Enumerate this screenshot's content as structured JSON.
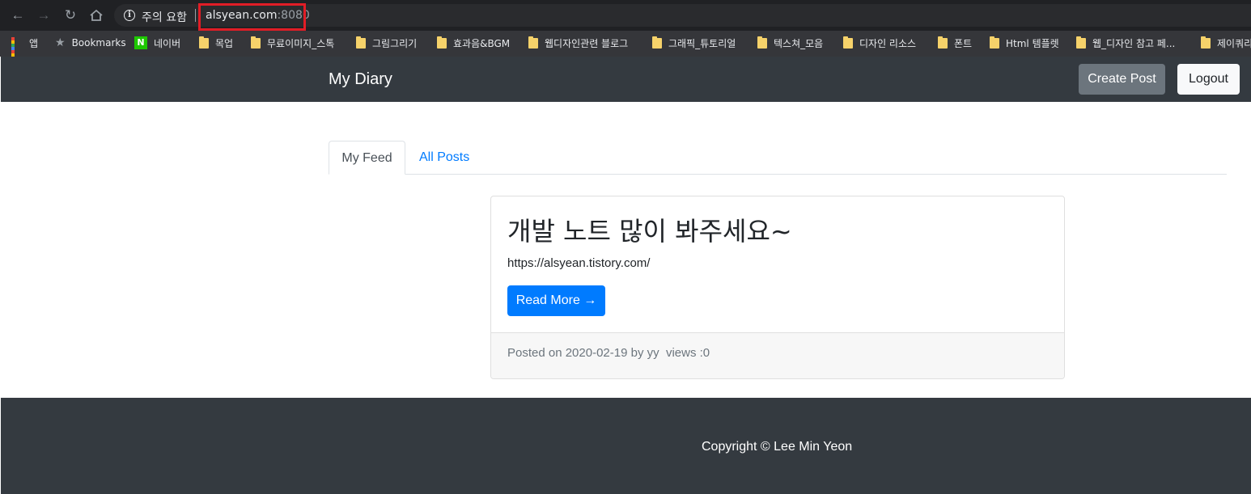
{
  "browser": {
    "security_label": "주의 요함",
    "url_host": "alsyean.com",
    "url_port": ":8080"
  },
  "bookmarks": [
    {
      "label": "앱",
      "icon": "apps-grid-icon"
    },
    {
      "label": "Bookmarks",
      "icon": "star-icon"
    },
    {
      "label": "네이버",
      "icon": "naver-icon"
    },
    {
      "label": "목업",
      "icon": "folder-icon"
    },
    {
      "label": "무료이미지_스톡",
      "icon": "folder-icon"
    },
    {
      "label": "그림그리기",
      "icon": "folder-icon"
    },
    {
      "label": "효과음&BGM",
      "icon": "folder-icon"
    },
    {
      "label": "웹디자인관련 블로그",
      "icon": "folder-icon"
    },
    {
      "label": "그래픽_튜토리얼",
      "icon": "folder-icon"
    },
    {
      "label": "텍스쳐_모음",
      "icon": "folder-icon"
    },
    {
      "label": "디자인 리소스",
      "icon": "folder-icon"
    },
    {
      "label": "폰트",
      "icon": "folder-icon"
    },
    {
      "label": "Html 템플렛",
      "icon": "folder-icon"
    },
    {
      "label": "웹_디자인 참고 페...",
      "icon": "folder-icon"
    },
    {
      "label": "제이쿼리",
      "icon": "folder-icon"
    }
  ],
  "navbar": {
    "brand": "My Diary",
    "create_label": "Create Post",
    "logout_label": "Logout"
  },
  "tabs": [
    {
      "label": "My Feed",
      "active": true
    },
    {
      "label": "All Posts",
      "active": false
    }
  ],
  "post": {
    "title": "개발 노트 많이 봐주세요~",
    "text": "https://alsyean.tistory.com/",
    "button": "Read More →",
    "footer": "Posted on 2020-02-19 by yy  views :0"
  },
  "footer": {
    "copyright": "Copyright © Lee Min Yeon"
  },
  "colors": {
    "navbar_bg": "#343a40",
    "primary": "#007bff",
    "secondary": "#6c757d",
    "highlight_box": "#e11d26"
  }
}
